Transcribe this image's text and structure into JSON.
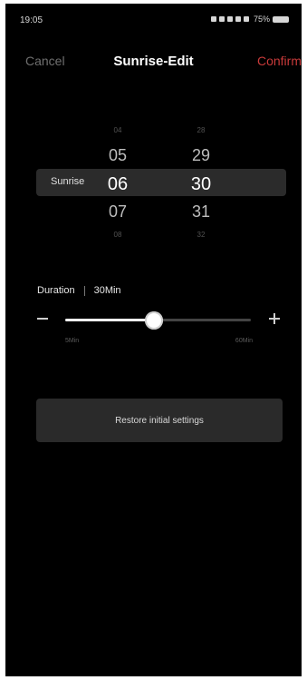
{
  "status": {
    "time": "19:05",
    "battery": "75%"
  },
  "header": {
    "cancel": "Cancel",
    "title": "Sunrise-Edit",
    "confirm": "Confirm"
  },
  "picker": {
    "row_label": "Sunrise",
    "hours": {
      "above2": "04",
      "above1": "05",
      "selected": "06",
      "below1": "07",
      "below2": "08"
    },
    "minutes": {
      "above2": "28",
      "above1": "29",
      "selected": "30",
      "below1": "31",
      "below2": "32"
    }
  },
  "duration": {
    "label": "Duration",
    "value": "30Min"
  },
  "slider": {
    "min_label": "5Min",
    "max_label": "60Min",
    "thumb_glyph": "||",
    "level_fraction": 0.48
  },
  "restore_button": "Restore initial settings",
  "colors": {
    "background": "#000000",
    "accent": "#c83a3a",
    "selection_bar": "#2b2b2b"
  }
}
